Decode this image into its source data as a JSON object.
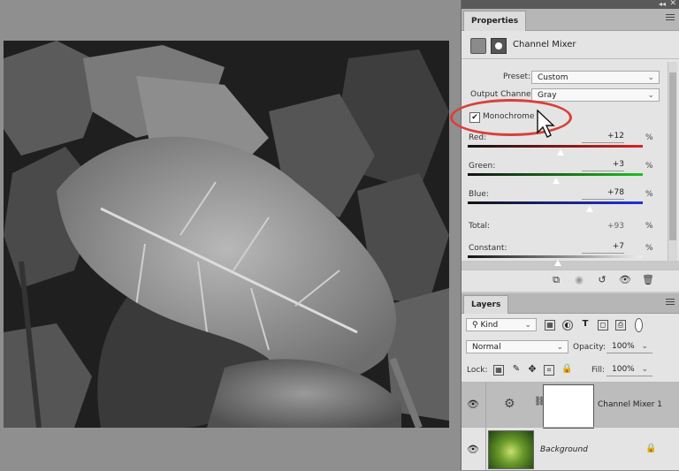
{
  "properties": {
    "tab_label": "Properties",
    "adjustment_title": "Channel Mixer",
    "preset_label": "Preset:",
    "preset_value": "Custom",
    "output_label": "Output Channel:",
    "output_value": "Gray",
    "monochrome_label": "Monochrome",
    "monochrome_checked": "✔",
    "red_label": "Red:",
    "red_value": "+12",
    "green_label": "Green:",
    "green_value": "+3",
    "blue_label": "Blue:",
    "blue_value": "+78",
    "total_label": "Total:",
    "total_value": "+93",
    "constant_label": "Constant:",
    "constant_value": "+7",
    "pct": "%"
  },
  "sliders": {
    "red": 0.12,
    "green": 0.03,
    "blue": 0.78,
    "constant": 0.07
  },
  "layers": {
    "tab_label": "Layers",
    "kind_label": "Kind",
    "blend_mode": "Normal",
    "opacity_label": "Opacity:",
    "opacity_value": "100%",
    "lock_label": "Lock:",
    "fill_label": "Fill:",
    "fill_value": "100%",
    "items": [
      {
        "name": "Channel Mixer 1"
      },
      {
        "name": "Background"
      }
    ]
  },
  "colors": {
    "highlight_circle": "#d9403a",
    "selected_layer": "#bcbcbc"
  }
}
